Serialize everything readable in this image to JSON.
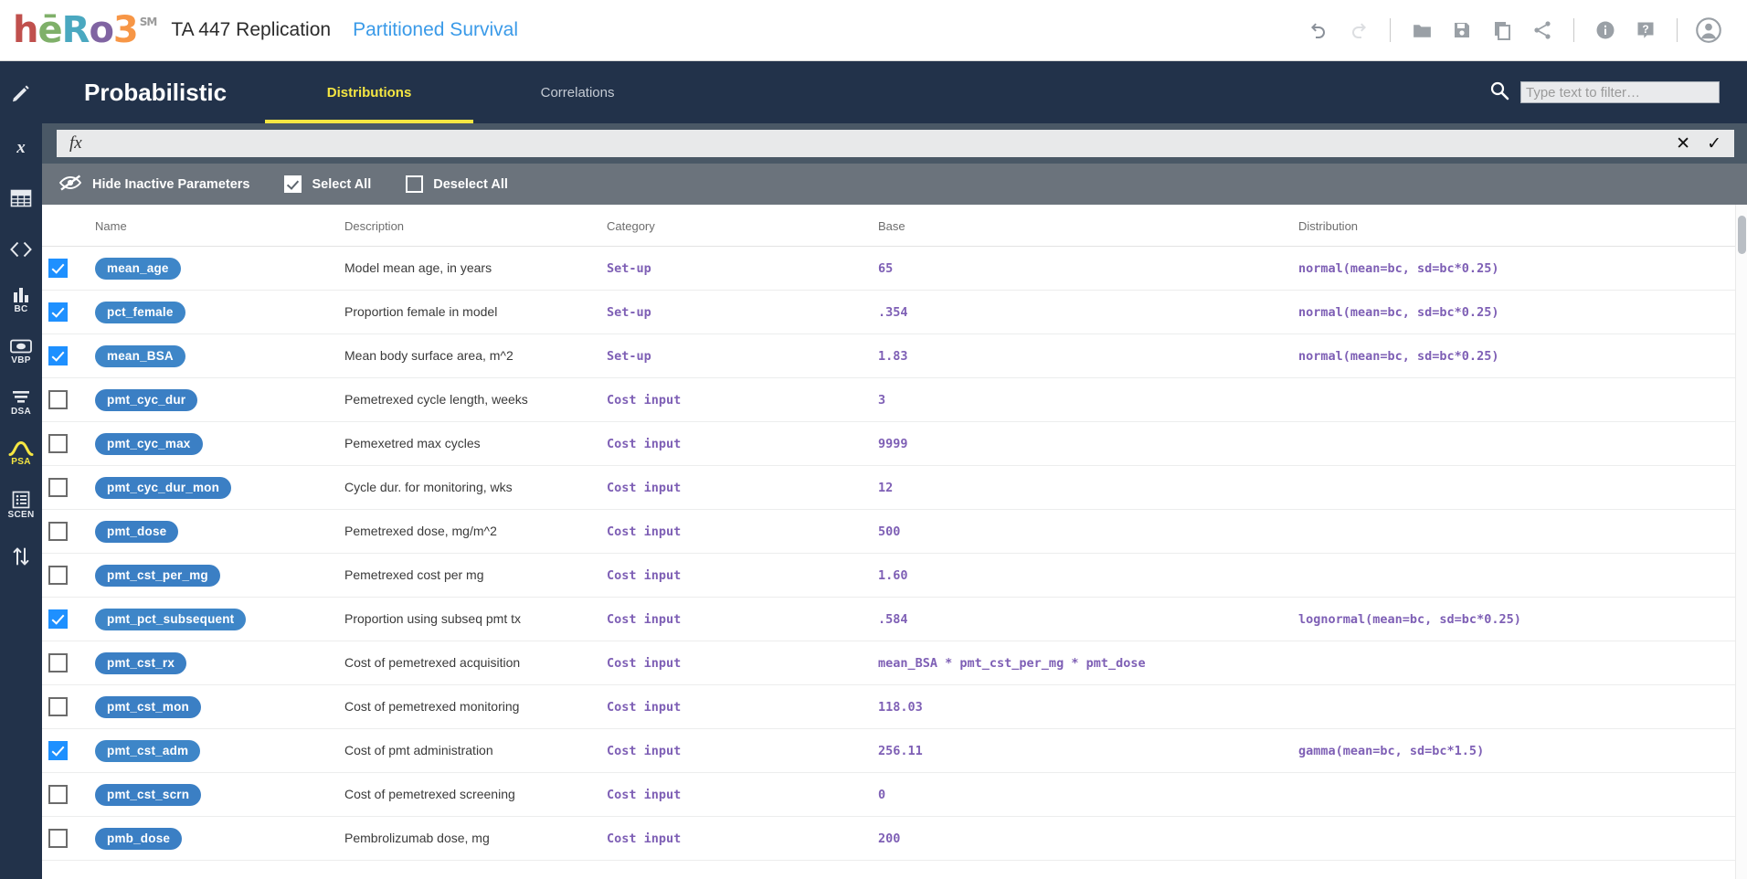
{
  "header": {
    "logo_text": "hēRo3",
    "logo_sm": "SM",
    "project_title": "TA 447 Replication",
    "submodel_title": "Partitioned Survival",
    "tools": [
      {
        "name": "undo-icon",
        "label": "Undo"
      },
      {
        "name": "redo-icon",
        "label": "Redo"
      },
      {
        "name": "folder-icon",
        "label": "Open"
      },
      {
        "name": "save-icon",
        "label": "Save"
      },
      {
        "name": "copy-icon",
        "label": "Copy"
      },
      {
        "name": "share-icon",
        "label": "Share"
      },
      {
        "name": "info-icon",
        "label": "Info"
      },
      {
        "name": "help-icon",
        "label": "Help"
      },
      {
        "name": "account-icon",
        "label": "Account"
      }
    ]
  },
  "sidebar": {
    "items": [
      {
        "name": "edit-icon",
        "label": "",
        "active": false
      },
      {
        "name": "variable-x-icon",
        "label": "",
        "active": false
      },
      {
        "name": "table-icon",
        "label": "",
        "active": false
      },
      {
        "name": "code-icon",
        "label": "",
        "active": false
      },
      {
        "name": "bar-chart-icon",
        "label": "BC",
        "active": false
      },
      {
        "name": "vbp-icon",
        "label": "VBP",
        "active": false
      },
      {
        "name": "dsa-icon",
        "label": "DSA",
        "active": false
      },
      {
        "name": "psa-icon",
        "label": "PSA",
        "active": true
      },
      {
        "name": "scen-icon",
        "label": "SCEN",
        "active": false
      },
      {
        "name": "sort-icon",
        "label": "",
        "active": false
      }
    ]
  },
  "page": {
    "title": "Probabilistic",
    "tabs": [
      {
        "label": "Distributions",
        "active": true
      },
      {
        "label": "Correlations",
        "active": false
      }
    ],
    "filter": {
      "placeholder": "Type text to filter…",
      "value": ""
    },
    "formula": {
      "prefix": "fx",
      "value": "",
      "cancel_label": "✕",
      "accept_label": "✓"
    },
    "actions": {
      "hide_inactive_label": "Hide Inactive Parameters",
      "select_all_label": "Select All",
      "select_all_checked": true,
      "deselect_all_label": "Deselect All",
      "deselect_all_checked": false
    }
  },
  "table": {
    "columns": [
      "Name",
      "Description",
      "Category",
      "Base",
      "Distribution"
    ],
    "rows": [
      {
        "checked": true,
        "name": "mean_age",
        "description": "Model mean age, in years",
        "category": "Set-up",
        "base": "65",
        "distribution": "normal(mean=bc, sd=bc*0.25)"
      },
      {
        "checked": true,
        "name": "pct_female",
        "description": "Proportion female in model",
        "category": "Set-up",
        "base": ".354",
        "distribution": "normal(mean=bc, sd=bc*0.25)"
      },
      {
        "checked": true,
        "name": "mean_BSA",
        "description": "Mean body surface area, m^2",
        "category": "Set-up",
        "base": "1.83",
        "distribution": "normal(mean=bc, sd=bc*0.25)"
      },
      {
        "checked": false,
        "name": "pmt_cyc_dur",
        "description": "Pemetrexed cycle length, weeks",
        "category": "Cost input",
        "base": "3",
        "distribution": ""
      },
      {
        "checked": false,
        "name": "pmt_cyc_max",
        "description": "Pemexetred max cycles",
        "category": "Cost input",
        "base": "9999",
        "distribution": ""
      },
      {
        "checked": false,
        "name": "pmt_cyc_dur_mon",
        "description": "Cycle dur. for monitoring, wks",
        "category": "Cost input",
        "base": "12",
        "distribution": ""
      },
      {
        "checked": false,
        "name": "pmt_dose",
        "description": "Pemetrexed dose, mg/m^2",
        "category": "Cost input",
        "base": "500",
        "distribution": ""
      },
      {
        "checked": false,
        "name": "pmt_cst_per_mg",
        "description": "Pemetrexed cost per mg",
        "category": "Cost input",
        "base": "1.60",
        "distribution": ""
      },
      {
        "checked": true,
        "name": "pmt_pct_subsequent",
        "description": "Proportion using subseq pmt tx",
        "category": "Cost input",
        "base": ".584",
        "distribution": "lognormal(mean=bc, sd=bc*0.25)"
      },
      {
        "checked": false,
        "name": "pmt_cst_rx",
        "description": "Cost of pemetrexed acquisition",
        "category": "Cost input",
        "base": "mean_BSA * pmt_cst_per_mg * pmt_dose",
        "distribution": ""
      },
      {
        "checked": false,
        "name": "pmt_cst_mon",
        "description": "Cost of pemetrexed monitoring",
        "category": "Cost input",
        "base": "118.03",
        "distribution": ""
      },
      {
        "checked": true,
        "name": "pmt_cst_adm",
        "description": "Cost of pmt administration",
        "category": "Cost input",
        "base": "256.11",
        "distribution": "gamma(mean=bc, sd=bc*1.5)"
      },
      {
        "checked": false,
        "name": "pmt_cst_scrn",
        "description": "Cost of pemetrexed screening",
        "category": "Cost input",
        "base": "0",
        "distribution": ""
      },
      {
        "checked": false,
        "name": "pmb_dose",
        "description": "Pembrolizumab dose, mg",
        "category": "Cost input",
        "base": "200",
        "distribution": ""
      }
    ]
  },
  "colors": {
    "navy": "#22324a",
    "accent_yellow": "#f5e642",
    "pill_blue": "#3b7fc4",
    "check_blue": "#1e90ff",
    "mono_purple": "#7e5fb5",
    "link_blue": "#3a9ae8",
    "fx_bar": "#4a5866",
    "action_bar": "#6b737c"
  }
}
